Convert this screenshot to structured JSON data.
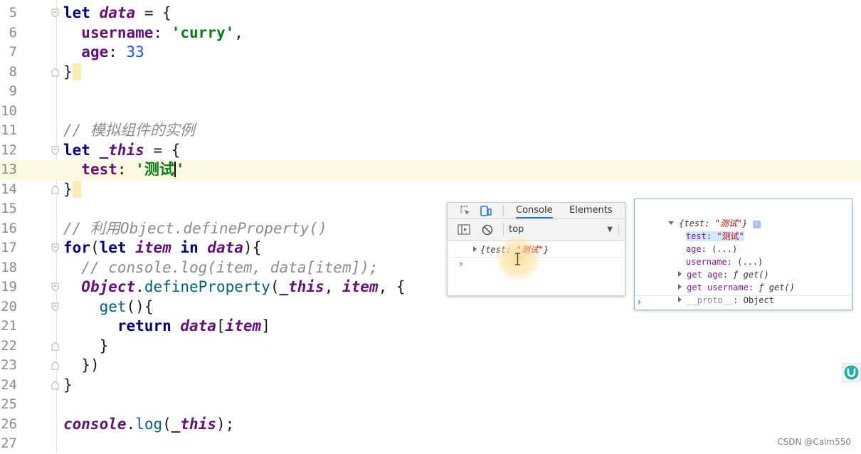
{
  "editor": {
    "lines": [
      {
        "n": "5"
      },
      {
        "n": "6"
      },
      {
        "n": "7"
      },
      {
        "n": "8"
      },
      {
        "n": "9"
      },
      {
        "n": "10"
      },
      {
        "n": "11"
      },
      {
        "n": "12"
      },
      {
        "n": "13"
      },
      {
        "n": "14"
      },
      {
        "n": "15"
      },
      {
        "n": "16"
      },
      {
        "n": "17"
      },
      {
        "n": "18"
      },
      {
        "n": "19"
      },
      {
        "n": "20"
      },
      {
        "n": "21"
      },
      {
        "n": "22"
      },
      {
        "n": "23"
      },
      {
        "n": "24"
      },
      {
        "n": "25"
      },
      {
        "n": "26"
      },
      {
        "n": "27"
      }
    ],
    "t": {
      "let": "let",
      "data": "data",
      "eq_brace": " = {",
      "username": "username",
      "colon": ": ",
      "curry": "'curry'",
      "comma": ",",
      "age": "age",
      "n33": "33",
      "close": "}",
      "comment1": "// 模拟组件的实例",
      "this": "_this",
      "test": "test",
      "test_val_open": "'测试",
      "test_val_close": "'",
      "comment2": "// 利用Object.defineProperty()",
      "for": "for",
      "lp": "(",
      "item": "item",
      "in": "in",
      "rp_brace": "){",
      "comment3": "// console.log(item, data[item]);",
      "Object": "Object",
      "dot": ".",
      "defineProperty": "defineProperty",
      "comma_sp": ", ",
      "comma_brace": ", {",
      "get": "get",
      "get_tail": "(){",
      "return": "return",
      "lb": "[",
      "rb": "]",
      "close_paren": "})",
      "console": "console",
      "log": "log",
      "rp_semi": ");"
    }
  },
  "devtools": {
    "tab_console": "Console",
    "tab_elements": "Elements",
    "context_value": "top",
    "log_entry_prefix": "{test: ",
    "log_entry_value": "\"测试\"",
    "log_entry_suffix": "}",
    "prompt": "›"
  },
  "expanded_object": {
    "header_prefix": "{test: ",
    "header_value": "\"测试\"",
    "header_suffix": "}",
    "info": "i",
    "rows": [
      {
        "key": "test",
        "sep": ": ",
        "value": "\"测试\""
      },
      {
        "key": "age",
        "sep": ": ",
        "value": "(...)"
      },
      {
        "key": "username",
        "sep": ": ",
        "value": "(...)"
      },
      {
        "key": "get age",
        "sep": ": ",
        "value": "ƒ get()"
      },
      {
        "key": "get username",
        "sep": ": ",
        "value": "ƒ get()"
      },
      {
        "key": "__proto__",
        "sep": ": ",
        "value": "Object"
      }
    ],
    "prompt": "›"
  },
  "watermark": "CSDN @Calm550",
  "colors": {
    "keyword": "#000080",
    "variable": "#660e7a",
    "string": "#067d17",
    "number": "#1750eb",
    "comment": "#8c8c8c",
    "current_line": "#fdf8e2",
    "console_accent": "#1a73e8"
  }
}
